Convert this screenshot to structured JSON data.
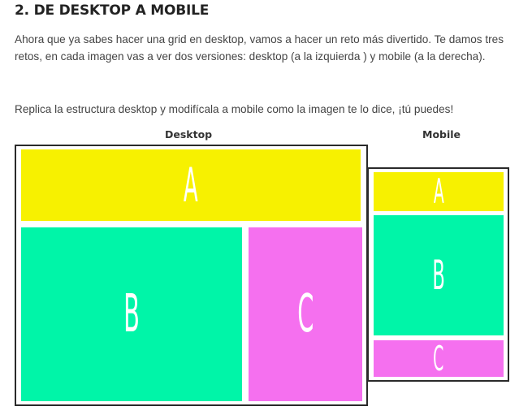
{
  "heading": "2. DE DESKTOP A MOBILE",
  "paragraphs": [
    "Ahora que ya sabes hacer una grid en desktop, vamos a hacer un reto más divertido. Te damos tres retos, en cada imagen vas a ver dos versiones: desktop (a la izquierda ) y mobile (a la derecha).",
    "Replica la estructura desktop y modifícala a mobile como la imagen te lo dice, ¡tú puedes!"
  ],
  "colors": {
    "block_a": "#f7f100",
    "block_b": "#00f5a8",
    "block_c": "#f570ef"
  },
  "figure": {
    "desktop": {
      "label": "Desktop",
      "blocks": [
        {
          "letter": "A"
        },
        {
          "letter": "B"
        },
        {
          "letter": "C"
        }
      ]
    },
    "mobile": {
      "label": "Mobile",
      "blocks": [
        {
          "letter": "A"
        },
        {
          "letter": "B"
        },
        {
          "letter": "C"
        }
      ]
    }
  }
}
